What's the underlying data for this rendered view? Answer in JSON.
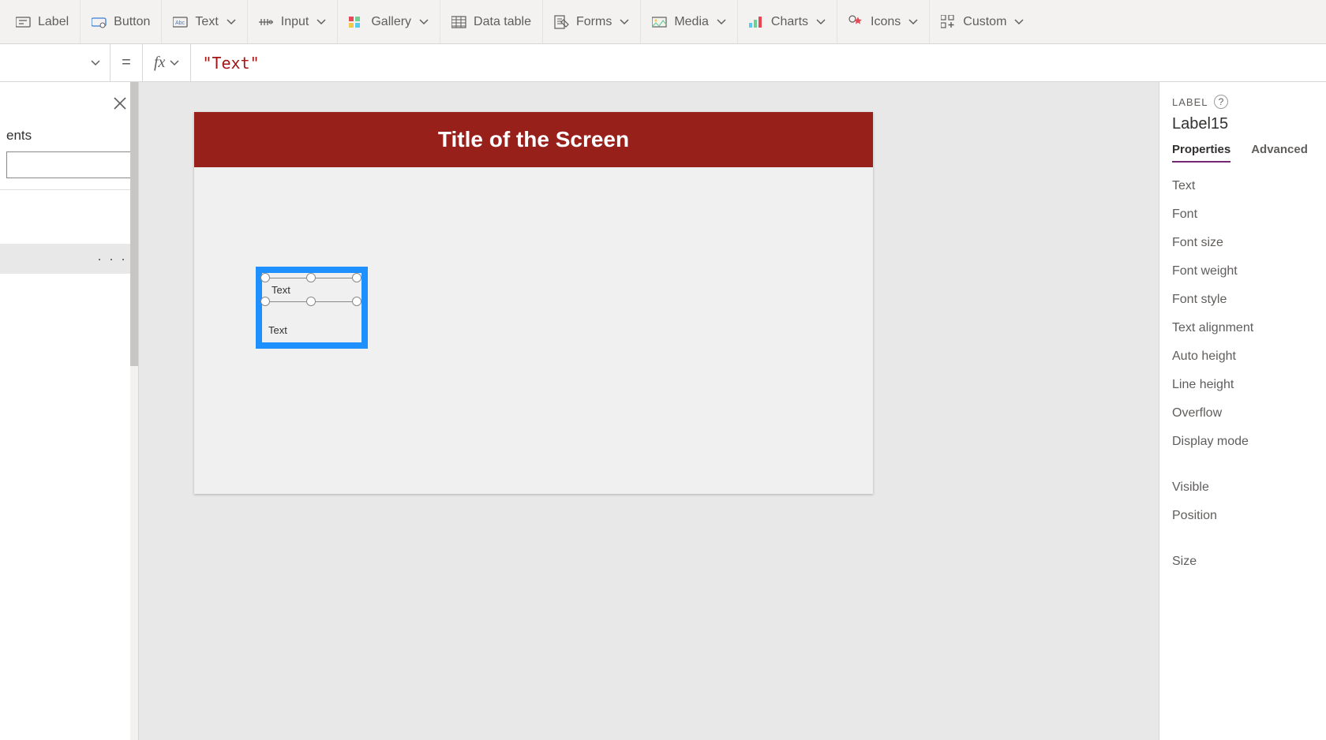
{
  "toolbar": {
    "items": [
      {
        "label": "Label",
        "icon": "label-icon",
        "has_menu": false
      },
      {
        "label": "Button",
        "icon": "button-icon",
        "has_menu": false
      },
      {
        "label": "Text",
        "icon": "text-icon",
        "has_menu": true
      },
      {
        "label": "Input",
        "icon": "input-icon",
        "has_menu": true
      },
      {
        "label": "Gallery",
        "icon": "gallery-icon",
        "has_menu": true
      },
      {
        "label": "Data table",
        "icon": "datatable-icon",
        "has_menu": false
      },
      {
        "label": "Forms",
        "icon": "forms-icon",
        "has_menu": true
      },
      {
        "label": "Media",
        "icon": "media-icon",
        "has_menu": true
      },
      {
        "label": "Charts",
        "icon": "charts-icon",
        "has_menu": true
      },
      {
        "label": "Icons",
        "icon": "icons-icon",
        "has_menu": true
      },
      {
        "label": "Custom",
        "icon": "custom-icon",
        "has_menu": true
      }
    ]
  },
  "formula": {
    "equals": "=",
    "fx": "fx",
    "value": "\"Text\""
  },
  "left_panel": {
    "title_suffix": "ents",
    "selected_ellipsis": "· · ·"
  },
  "canvas": {
    "title": "Title of the Screen",
    "label_inner_text": "Text",
    "label_outer_text": "Text"
  },
  "right_panel": {
    "type_caption": "LABEL",
    "name": "Label15",
    "tabs": {
      "properties": "Properties",
      "advanced": "Advanced"
    },
    "items": [
      "Text",
      "Font",
      "Font size",
      "Font weight",
      "Font style",
      "Text alignment",
      "Auto height",
      "Line height",
      "Overflow",
      "Display mode"
    ],
    "items2": [
      "Visible",
      "Position",
      "Size"
    ]
  }
}
